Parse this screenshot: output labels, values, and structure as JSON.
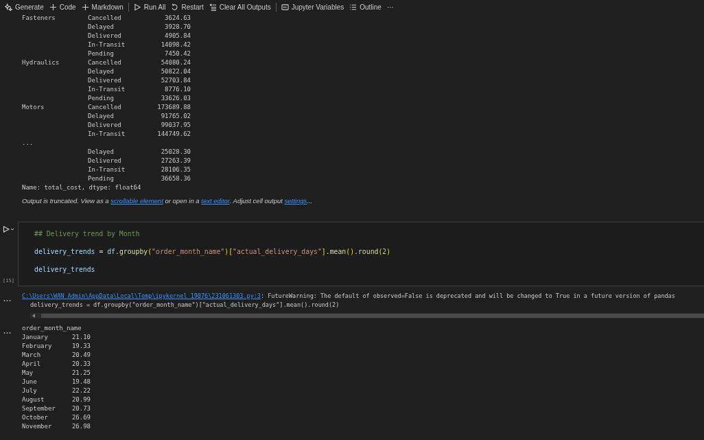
{
  "toolbar": [
    {
      "kind": "button",
      "label": "Generate"
    },
    {
      "kind": "button",
      "label": "Code"
    },
    {
      "kind": "button",
      "label": "Markdown"
    },
    {
      "kind": "separator"
    },
    {
      "kind": "button",
      "label": "Run All"
    },
    {
      "kind": "button",
      "label": "Restart"
    },
    {
      "kind": "button",
      "label": "Clear All Outputs"
    },
    {
      "kind": "separator"
    },
    {
      "kind": "button",
      "label": "Jupyter Variables"
    },
    {
      "kind": "button",
      "label": "Outline"
    },
    {
      "kind": "button",
      "label": "···"
    }
  ],
  "cost_output": {
    "rows": [
      {
        "category": "Fasteners",
        "status": "Cancelled",
        "value": "3624.63"
      },
      {
        "status": "Delayed",
        "value": "3928.70"
      },
      {
        "status": "Delivered",
        "value": "4905.84"
      },
      {
        "status": "In-Transit",
        "value": "14098.42"
      },
      {
        "status": "Pending",
        "value": "7450.42"
      },
      {
        "category": "Hydraulics",
        "status": "Cancelled",
        "value": "54080.24"
      },
      {
        "status": "Delayed",
        "value": "50822.04"
      },
      {
        "status": "Delivered",
        "value": "52703.84"
      },
      {
        "status": "In-Transit",
        "value": "8776.10"
      },
      {
        "status": "Pending",
        "value": "33626.03"
      },
      {
        "category": "Motors",
        "status": "Cancelled",
        "value": "173689.88"
      },
      {
        "status": "Delayed",
        "value": "91765.02"
      },
      {
        "status": "Delivered",
        "value": "99037.95"
      },
      {
        "status": "In-Transit",
        "value": "144749.62"
      },
      {
        "category": "..."
      },
      {
        "status": "Delayed",
        "value": "25028.30"
      },
      {
        "status": "Delivered",
        "value": "27263.39"
      },
      {
        "status": "In-Transit",
        "value": "28106.35"
      },
      {
        "status": "Pending",
        "value": "36658.36"
      }
    ],
    "footer": "Name: total_cost, dtype: float64",
    "truncation_note": [
      {
        "text": "Output is truncated. View as a ",
        "kind": "text"
      },
      {
        "text": "scrollable element",
        "kind": "link"
      },
      {
        "text": " or open in a ",
        "kind": "text"
      },
      {
        "text": "text editor",
        "kind": "link"
      },
      {
        "text": ". Adjust cell output ",
        "kind": "text"
      },
      {
        "text": "settings",
        "kind": "link"
      },
      {
        "text": "...",
        "kind": "text"
      }
    ]
  },
  "code_cell": {
    "execution_count": "[15]",
    "lines": [
      [
        {
          "text": "## Delivery trend by Month",
          "kind": "comment"
        }
      ],
      [
        {
          "text": "delivery_trends",
          "kind": "variable"
        },
        {
          "text": " = ",
          "kind": "operator"
        },
        {
          "text": "df",
          "kind": "variable"
        },
        {
          "text": ".",
          "kind": "operator"
        },
        {
          "text": "groupby",
          "kind": "function"
        },
        {
          "text": "(",
          "kind": "paren"
        },
        {
          "text": "\"order_month_name\"",
          "kind": "string"
        },
        {
          "text": ")",
          "kind": "paren"
        },
        {
          "text": "[",
          "kind": "paren"
        },
        {
          "text": "\"actual_delivery_days\"",
          "kind": "string"
        },
        {
          "text": "]",
          "kind": "paren"
        },
        {
          "text": ".",
          "kind": "operator"
        },
        {
          "text": "mean",
          "kind": "function"
        },
        {
          "text": "()",
          "kind": "paren"
        },
        {
          "text": ".",
          "kind": "operator"
        },
        {
          "text": "round",
          "kind": "function"
        },
        {
          "text": "(",
          "kind": "paren"
        },
        {
          "text": "2",
          "kind": "number"
        },
        {
          "text": ")",
          "kind": "paren"
        }
      ],
      [
        {
          "text": "delivery_trends",
          "kind": "variable"
        }
      ]
    ]
  },
  "warning_output": {
    "path": "C:\\Users\\WAN_Admin\\AppData\\Local\\Temp\\ipykernel_19076\\231061303.py:3",
    "message": ": FutureWarning: The default of observed=False is deprecated and will be changed to True in a future version of pandas",
    "source_line": "delivery_trends = df.groupby(\"order_month_name\")[\"actual_delivery_days\"].mean().round(2)"
  },
  "month_output": {
    "header": "order_month_name",
    "rows": [
      {
        "month": "January",
        "value": "21.10"
      },
      {
        "month": "February",
        "value": "19.33"
      },
      {
        "month": "March",
        "value": "20.49"
      },
      {
        "month": "April",
        "value": "20.33"
      },
      {
        "month": "May",
        "value": "21.25"
      },
      {
        "month": "June",
        "value": "19.48"
      },
      {
        "month": "July",
        "value": "22.22"
      },
      {
        "month": "August",
        "value": "20.99"
      },
      {
        "month": "September",
        "value": "20.73"
      },
      {
        "month": "October",
        "value": "26.69"
      },
      {
        "month": "November",
        "value": "26.98"
      }
    ]
  }
}
